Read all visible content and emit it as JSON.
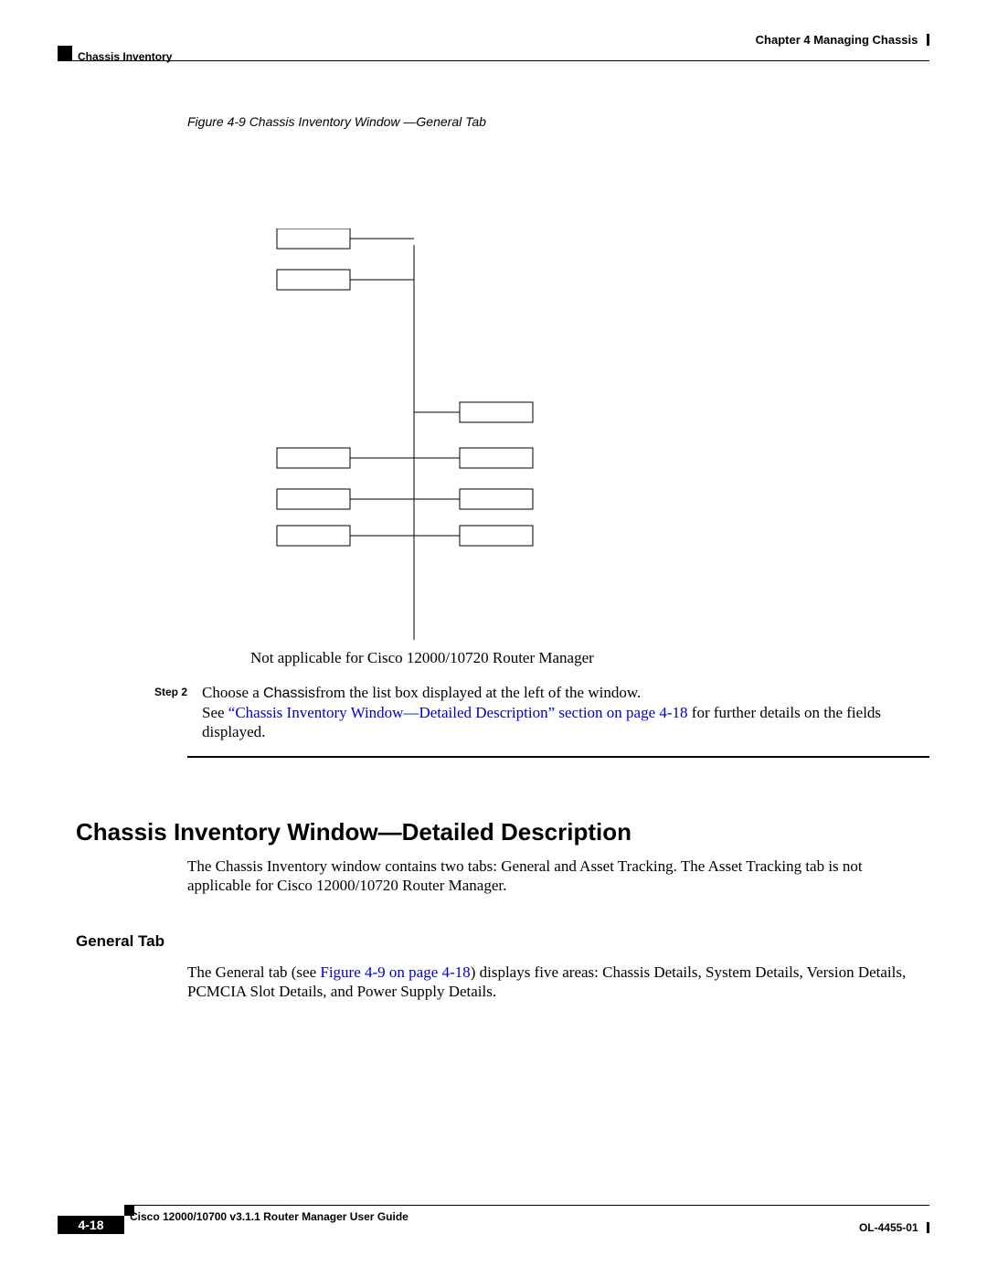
{
  "header": {
    "chapter_label": "Chapter 4    Managing Chassis",
    "section_label": "Chassis Inventory"
  },
  "figure": {
    "caption": "Figure 4-9    Chassis Inventory Window —General Tab",
    "note": "Not applicable for Cisco 12000/10720 Router Manager"
  },
  "step": {
    "label": "Step 2",
    "prefix": "Choose a ",
    "chassis_word": "Chassis",
    "suffix": "from the list box displayed at the left of the window.",
    "see_prefix": "See ",
    "link_text": "“Chassis Inventory Window—Detailed Description” section on page 4-18",
    "see_suffix": " for further details on the fields displayed."
  },
  "h2": "Chassis Inventory Window—Detailed Description",
  "body_h2": "The Chassis Inventory window contains two tabs: General and Asset Tracking. The Asset Tracking tab is not applicable for Cisco 12000/10720 Router Manager.",
  "h3": "General Tab",
  "body_h3_prefix": "The General tab (see ",
  "body_h3_link": "Figure 4-9 on page 4-18",
  "body_h3_suffix": ") displays five areas: Chassis Details, System Details, Version Details, PCMCIA Slot Details, and Power Supply Details.",
  "footer": {
    "guide_title": "Cisco 12000/10700 v3.1.1 Router Manager User Guide",
    "doc_id": "OL-4455-01",
    "page_number": "4-18"
  }
}
